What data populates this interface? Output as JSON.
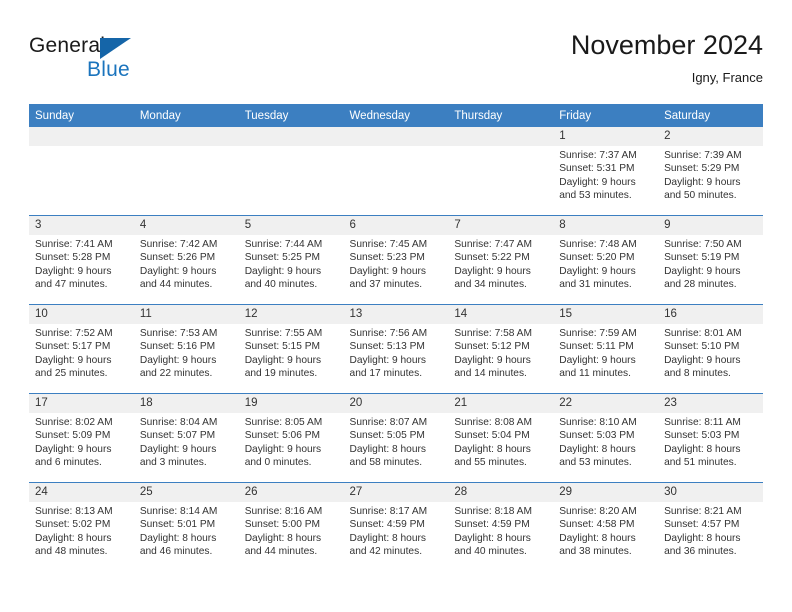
{
  "brand": {
    "name_part1": "General",
    "name_part2": "Blue",
    "logo_icon": "triangle-logo-icon",
    "accent_color": "#1b74bd"
  },
  "header": {
    "title": "November 2024",
    "location": "Igny, France"
  },
  "theme": {
    "header_row_bg": "#3c7fc1",
    "daynum_bg": "#f0f0f0",
    "row_separator": "#3c7fc1",
    "text": "#333333"
  },
  "calendar": {
    "weekday_headers": [
      "Sunday",
      "Monday",
      "Tuesday",
      "Wednesday",
      "Thursday",
      "Friday",
      "Saturday"
    ],
    "labels": {
      "sunrise": "Sunrise:",
      "sunset": "Sunset:",
      "daylight": "Daylight:"
    },
    "weeks": [
      [
        {
          "day": "",
          "empty": true,
          "sunrise": "",
          "sunset": "",
          "daylight_line1": "",
          "daylight_line2": ""
        },
        {
          "day": "",
          "empty": true,
          "sunrise": "",
          "sunset": "",
          "daylight_line1": "",
          "daylight_line2": ""
        },
        {
          "day": "",
          "empty": true,
          "sunrise": "",
          "sunset": "",
          "daylight_line1": "",
          "daylight_line2": ""
        },
        {
          "day": "",
          "empty": true,
          "sunrise": "",
          "sunset": "",
          "daylight_line1": "",
          "daylight_line2": ""
        },
        {
          "day": "",
          "empty": true,
          "sunrise": "",
          "sunset": "",
          "daylight_line1": "",
          "daylight_line2": ""
        },
        {
          "day": "1",
          "empty": false,
          "sunrise": "Sunrise: 7:37 AM",
          "sunset": "Sunset: 5:31 PM",
          "daylight_line1": "Daylight: 9 hours",
          "daylight_line2": "and 53 minutes."
        },
        {
          "day": "2",
          "empty": false,
          "sunrise": "Sunrise: 7:39 AM",
          "sunset": "Sunset: 5:29 PM",
          "daylight_line1": "Daylight: 9 hours",
          "daylight_line2": "and 50 minutes."
        }
      ],
      [
        {
          "day": "3",
          "empty": false,
          "sunrise": "Sunrise: 7:41 AM",
          "sunset": "Sunset: 5:28 PM",
          "daylight_line1": "Daylight: 9 hours",
          "daylight_line2": "and 47 minutes."
        },
        {
          "day": "4",
          "empty": false,
          "sunrise": "Sunrise: 7:42 AM",
          "sunset": "Sunset: 5:26 PM",
          "daylight_line1": "Daylight: 9 hours",
          "daylight_line2": "and 44 minutes."
        },
        {
          "day": "5",
          "empty": false,
          "sunrise": "Sunrise: 7:44 AM",
          "sunset": "Sunset: 5:25 PM",
          "daylight_line1": "Daylight: 9 hours",
          "daylight_line2": "and 40 minutes."
        },
        {
          "day": "6",
          "empty": false,
          "sunrise": "Sunrise: 7:45 AM",
          "sunset": "Sunset: 5:23 PM",
          "daylight_line1": "Daylight: 9 hours",
          "daylight_line2": "and 37 minutes."
        },
        {
          "day": "7",
          "empty": false,
          "sunrise": "Sunrise: 7:47 AM",
          "sunset": "Sunset: 5:22 PM",
          "daylight_line1": "Daylight: 9 hours",
          "daylight_line2": "and 34 minutes."
        },
        {
          "day": "8",
          "empty": false,
          "sunrise": "Sunrise: 7:48 AM",
          "sunset": "Sunset: 5:20 PM",
          "daylight_line1": "Daylight: 9 hours",
          "daylight_line2": "and 31 minutes."
        },
        {
          "day": "9",
          "empty": false,
          "sunrise": "Sunrise: 7:50 AM",
          "sunset": "Sunset: 5:19 PM",
          "daylight_line1": "Daylight: 9 hours",
          "daylight_line2": "and 28 minutes."
        }
      ],
      [
        {
          "day": "10",
          "empty": false,
          "sunrise": "Sunrise: 7:52 AM",
          "sunset": "Sunset: 5:17 PM",
          "daylight_line1": "Daylight: 9 hours",
          "daylight_line2": "and 25 minutes."
        },
        {
          "day": "11",
          "empty": false,
          "sunrise": "Sunrise: 7:53 AM",
          "sunset": "Sunset: 5:16 PM",
          "daylight_line1": "Daylight: 9 hours",
          "daylight_line2": "and 22 minutes."
        },
        {
          "day": "12",
          "empty": false,
          "sunrise": "Sunrise: 7:55 AM",
          "sunset": "Sunset: 5:15 PM",
          "daylight_line1": "Daylight: 9 hours",
          "daylight_line2": "and 19 minutes."
        },
        {
          "day": "13",
          "empty": false,
          "sunrise": "Sunrise: 7:56 AM",
          "sunset": "Sunset: 5:13 PM",
          "daylight_line1": "Daylight: 9 hours",
          "daylight_line2": "and 17 minutes."
        },
        {
          "day": "14",
          "empty": false,
          "sunrise": "Sunrise: 7:58 AM",
          "sunset": "Sunset: 5:12 PM",
          "daylight_line1": "Daylight: 9 hours",
          "daylight_line2": "and 14 minutes."
        },
        {
          "day": "15",
          "empty": false,
          "sunrise": "Sunrise: 7:59 AM",
          "sunset": "Sunset: 5:11 PM",
          "daylight_line1": "Daylight: 9 hours",
          "daylight_line2": "and 11 minutes."
        },
        {
          "day": "16",
          "empty": false,
          "sunrise": "Sunrise: 8:01 AM",
          "sunset": "Sunset: 5:10 PM",
          "daylight_line1": "Daylight: 9 hours",
          "daylight_line2": "and 8 minutes."
        }
      ],
      [
        {
          "day": "17",
          "empty": false,
          "sunrise": "Sunrise: 8:02 AM",
          "sunset": "Sunset: 5:09 PM",
          "daylight_line1": "Daylight: 9 hours",
          "daylight_line2": "and 6 minutes."
        },
        {
          "day": "18",
          "empty": false,
          "sunrise": "Sunrise: 8:04 AM",
          "sunset": "Sunset: 5:07 PM",
          "daylight_line1": "Daylight: 9 hours",
          "daylight_line2": "and 3 minutes."
        },
        {
          "day": "19",
          "empty": false,
          "sunrise": "Sunrise: 8:05 AM",
          "sunset": "Sunset: 5:06 PM",
          "daylight_line1": "Daylight: 9 hours",
          "daylight_line2": "and 0 minutes."
        },
        {
          "day": "20",
          "empty": false,
          "sunrise": "Sunrise: 8:07 AM",
          "sunset": "Sunset: 5:05 PM",
          "daylight_line1": "Daylight: 8 hours",
          "daylight_line2": "and 58 minutes."
        },
        {
          "day": "21",
          "empty": false,
          "sunrise": "Sunrise: 8:08 AM",
          "sunset": "Sunset: 5:04 PM",
          "daylight_line1": "Daylight: 8 hours",
          "daylight_line2": "and 55 minutes."
        },
        {
          "day": "22",
          "empty": false,
          "sunrise": "Sunrise: 8:10 AM",
          "sunset": "Sunset: 5:03 PM",
          "daylight_line1": "Daylight: 8 hours",
          "daylight_line2": "and 53 minutes."
        },
        {
          "day": "23",
          "empty": false,
          "sunrise": "Sunrise: 8:11 AM",
          "sunset": "Sunset: 5:03 PM",
          "daylight_line1": "Daylight: 8 hours",
          "daylight_line2": "and 51 minutes."
        }
      ],
      [
        {
          "day": "24",
          "empty": false,
          "sunrise": "Sunrise: 8:13 AM",
          "sunset": "Sunset: 5:02 PM",
          "daylight_line1": "Daylight: 8 hours",
          "daylight_line2": "and 48 minutes."
        },
        {
          "day": "25",
          "empty": false,
          "sunrise": "Sunrise: 8:14 AM",
          "sunset": "Sunset: 5:01 PM",
          "daylight_line1": "Daylight: 8 hours",
          "daylight_line2": "and 46 minutes."
        },
        {
          "day": "26",
          "empty": false,
          "sunrise": "Sunrise: 8:16 AM",
          "sunset": "Sunset: 5:00 PM",
          "daylight_line1": "Daylight: 8 hours",
          "daylight_line2": "and 44 minutes."
        },
        {
          "day": "27",
          "empty": false,
          "sunrise": "Sunrise: 8:17 AM",
          "sunset": "Sunset: 4:59 PM",
          "daylight_line1": "Daylight: 8 hours",
          "daylight_line2": "and 42 minutes."
        },
        {
          "day": "28",
          "empty": false,
          "sunrise": "Sunrise: 8:18 AM",
          "sunset": "Sunset: 4:59 PM",
          "daylight_line1": "Daylight: 8 hours",
          "daylight_line2": "and 40 minutes."
        },
        {
          "day": "29",
          "empty": false,
          "sunrise": "Sunrise: 8:20 AM",
          "sunset": "Sunset: 4:58 PM",
          "daylight_line1": "Daylight: 8 hours",
          "daylight_line2": "and 38 minutes."
        },
        {
          "day": "30",
          "empty": false,
          "sunrise": "Sunrise: 8:21 AM",
          "sunset": "Sunset: 4:57 PM",
          "daylight_line1": "Daylight: 8 hours",
          "daylight_line2": "and 36 minutes."
        }
      ]
    ]
  }
}
